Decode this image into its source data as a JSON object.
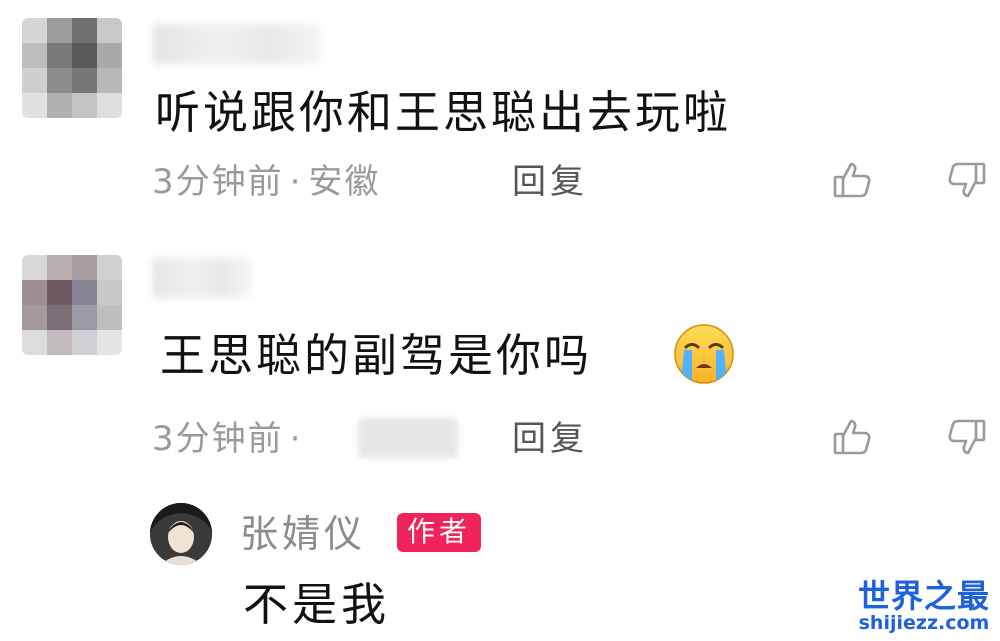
{
  "comments": [
    {
      "text": "听说跟你和王思聪出去玩啦",
      "time": "3分钟前",
      "separator": "·",
      "location": "安徽",
      "reply_label": "回复"
    },
    {
      "text": "王思聪的副驾是你吗",
      "time": "3分钟前",
      "separator": "·",
      "location": "",
      "reply_label": "回复",
      "emoji": "loudly-crying-face"
    }
  ],
  "author_reply": {
    "name": "张婧仪",
    "badge": "作者",
    "text": "不是我"
  },
  "watermark": {
    "title": "世界之最",
    "url": "shijiezz.com"
  },
  "colors": {
    "badge_bg": "#f0245a",
    "meta_text": "#9a9a9a",
    "watermark": "#1d62da"
  }
}
